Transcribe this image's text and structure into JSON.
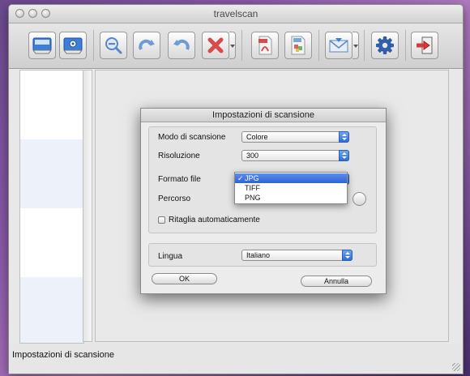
{
  "window": {
    "title": "travelscan"
  },
  "toolbar": {
    "buttons": [
      {
        "name": "scan-icon"
      },
      {
        "name": "scan-settings-icon"
      },
      {
        "name": "zoom-out-icon"
      },
      {
        "name": "redo-icon"
      },
      {
        "name": "undo-icon"
      },
      {
        "name": "delete-icon"
      },
      {
        "name": "pdf-icon"
      },
      {
        "name": "export-image-icon"
      },
      {
        "name": "email-icon"
      },
      {
        "name": "gear-icon"
      },
      {
        "name": "exit-icon"
      }
    ]
  },
  "status": {
    "text": "Impostazioni di scansione"
  },
  "dialog": {
    "title": "Impostazioni di scansione",
    "scan_mode": {
      "label": "Modo di scansione",
      "value": "Colore"
    },
    "resolution": {
      "label": "Risoluzione",
      "value": "300"
    },
    "file_format": {
      "label": "Formato file",
      "options": [
        "JPG",
        "TIFF",
        "PNG"
      ],
      "selected": "JPG",
      "check": "✓"
    },
    "path": {
      "label": "Percorso"
    },
    "auto_crop": {
      "label": "Ritaglia automaticamente",
      "checked": false
    },
    "language": {
      "label": "Lingua",
      "value": "Italiano"
    },
    "ok_label": "OK",
    "cancel_label": "Annulla"
  },
  "colors": {
    "selection": "#2f62d4",
    "popup_arrow": "#3a78e0"
  }
}
